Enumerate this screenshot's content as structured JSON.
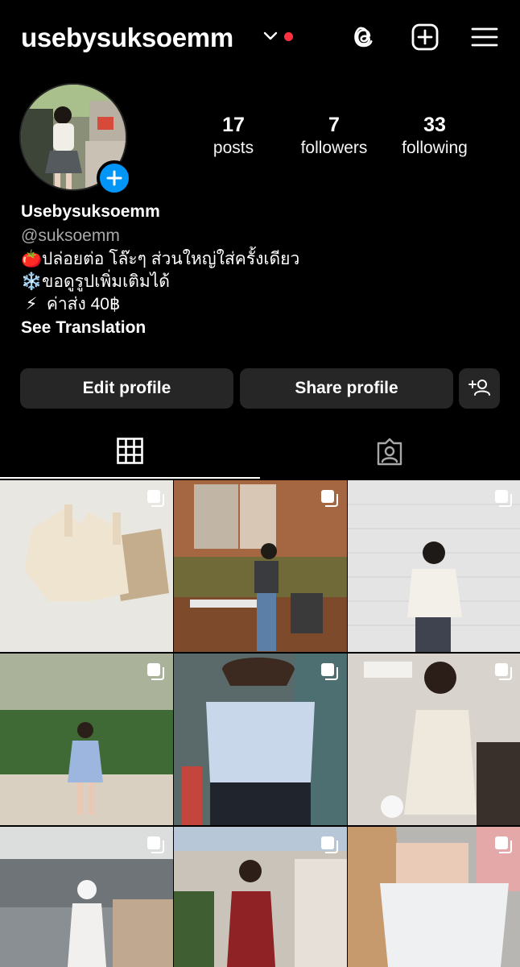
{
  "header": {
    "username": "usebysuksoemm",
    "icons": [
      "threads-icon",
      "create-icon",
      "menu-icon"
    ],
    "notification_color": "#ff3040"
  },
  "stats": {
    "posts": {
      "value": "17",
      "label": "posts"
    },
    "followers": {
      "value": "7",
      "label": "followers"
    },
    "following": {
      "value": "33",
      "label": "following"
    }
  },
  "bio": {
    "name": "Usebysuksoemm",
    "handle": "@suksoemm",
    "lines": [
      {
        "emoji": "🍅",
        "text": "ปล่อยต่อ โล๊ะๆ ส่วนใหญ่ใส่ครั้งเดียว"
      },
      {
        "emoji": "❄️",
        "text": "ขอดูรูปเพิ่มเติมได้"
      },
      {
        "emoji": "⚡",
        "text": " ค่าส่ง 40฿"
      }
    ],
    "see_translation": "See Translation"
  },
  "actions": {
    "edit_profile": "Edit profile",
    "share_profile": "Share profile"
  },
  "tabs": [
    "grid-icon",
    "tagged-icon"
  ],
  "grid": {
    "posts": [
      {
        "name": "post-lace-top",
        "multi": true
      },
      {
        "name": "post-kitchen-outfit",
        "multi": true
      },
      {
        "name": "post-graphic-tee",
        "multi": true
      },
      {
        "name": "post-beach-dress",
        "multi": true
      },
      {
        "name": "post-blue-crop-tee",
        "multi": true
      },
      {
        "name": "post-satin-dress",
        "multi": true
      },
      {
        "name": "post-cafe-outfit",
        "multi": true
      },
      {
        "name": "post-red-dress",
        "multi": true
      },
      {
        "name": "post-offshoulder-top",
        "multi": true
      }
    ]
  },
  "colors": {
    "background": "#000000",
    "button_bg": "#262626",
    "accent_blue": "#0095f6",
    "secondary_text": "#a8a8a8"
  }
}
